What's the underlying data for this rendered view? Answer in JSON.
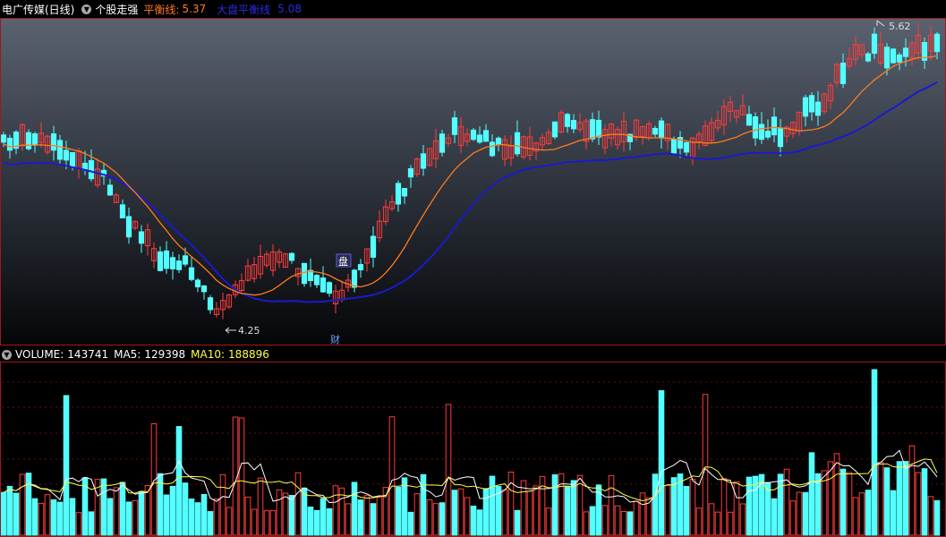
{
  "header": {
    "stock_name": "电广传媒(日线)",
    "indicator_name": "个股走强",
    "balance_label": "平衡线:",
    "balance_value": "5.37",
    "market_balance_label": "大盘平衡线",
    "market_balance_value": "5.08"
  },
  "volume_header": {
    "volume_label": "VOLUME:",
    "volume_value": "143741",
    "ma5_label": "MA5:",
    "ma5_value": "129398",
    "ma10_label": "MA10:",
    "ma10_value": "188896"
  },
  "annotations": {
    "high_label": "5.62",
    "low_label": "4.25",
    "marker_pan": "盘",
    "marker_cai": "财"
  },
  "colors": {
    "up": "#ff3c3c",
    "down": "#54ffff",
    "balance": "#ff7b1c",
    "market_balance": "#1a1acc",
    "title_text": "#ffffff",
    "ma5": "#ffffff",
    "ma10": "#ffff4a",
    "border": "#a01818"
  },
  "icons": {
    "header_dropdown": "chevron-down-icon",
    "volume_dropdown": "chevron-down-icon"
  }
}
